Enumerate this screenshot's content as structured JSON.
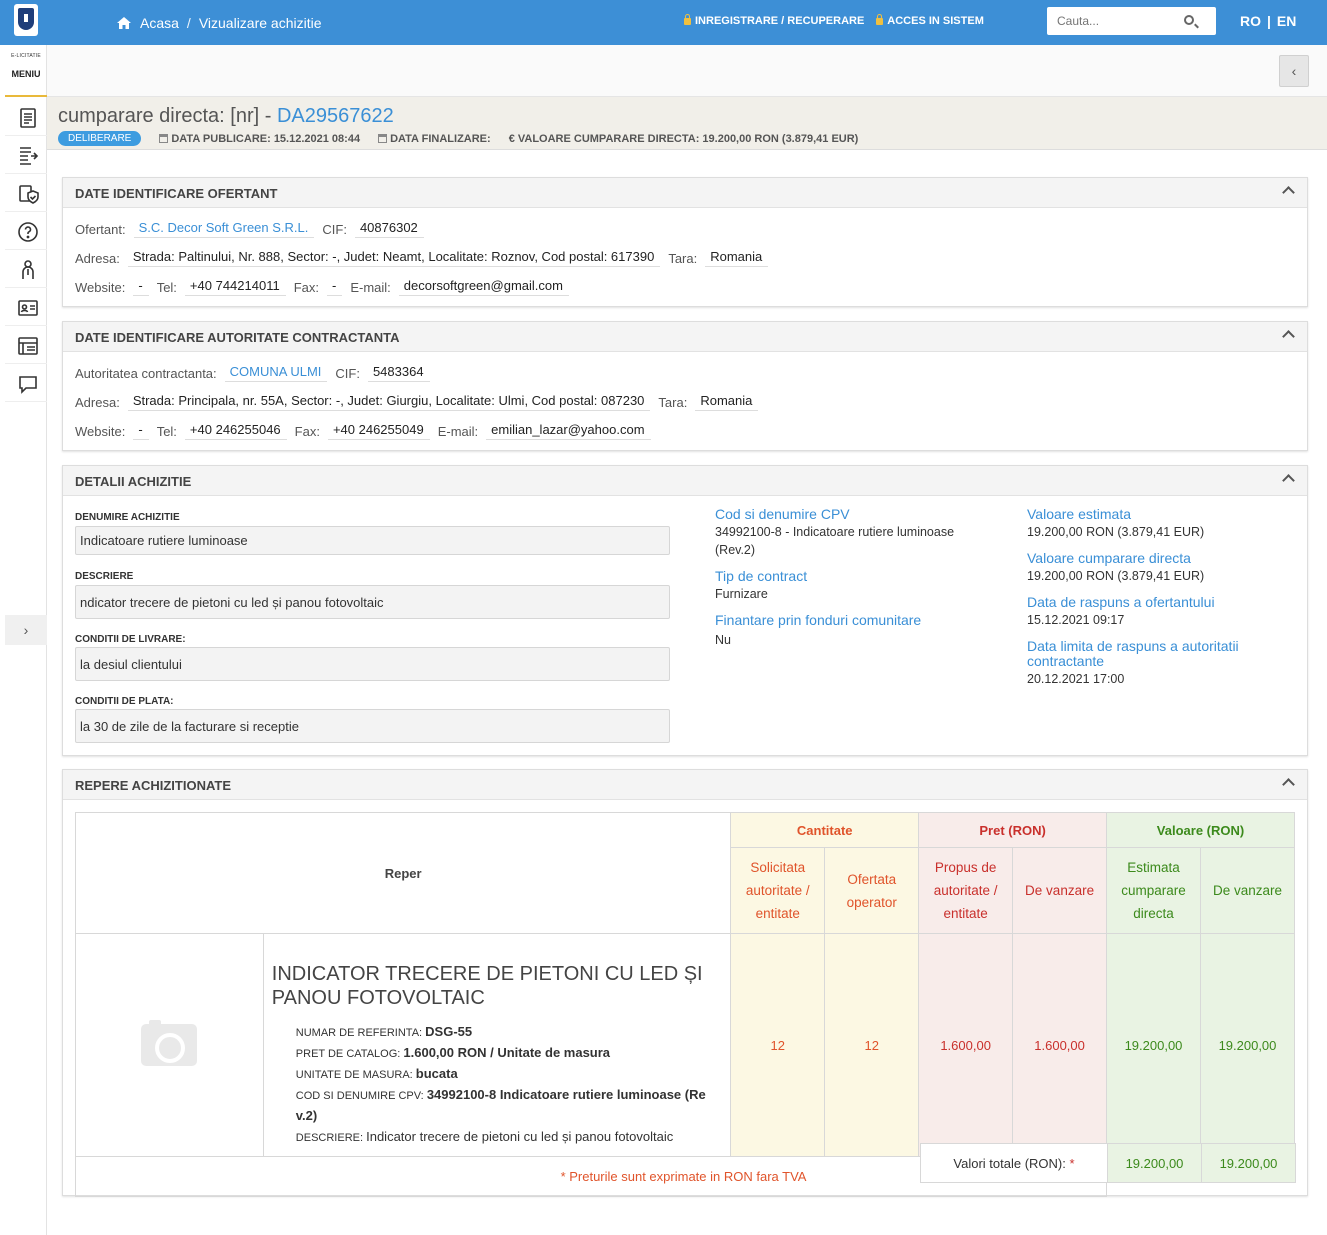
{
  "topbar": {
    "home_label": "Acasa",
    "crumb_sep": "/",
    "crumb_current": "Vizualizare achizitie",
    "register_label": "INREGISTRARE / RECUPERARE",
    "login_label": "ACCES IN SISTEM",
    "search_placeholder": "Cauta...",
    "lang_ro": "RO",
    "lang_sep": "|",
    "lang_en": "EN"
  },
  "sidebar": {
    "brand": "E-LICITATIE",
    "menu_label": "MENIU",
    "icons": [
      "document-icon",
      "export-list-icon",
      "shield-check-icon",
      "help-icon",
      "user-tie-icon",
      "id-card-icon",
      "catalog-icon",
      "chat-icon"
    ],
    "toggle": "›"
  },
  "subbar": {
    "collapse": "‹"
  },
  "header": {
    "title_prefix": "cumparare directa: [nr] - ",
    "code": "DA29567622",
    "status": "DELIBERARE",
    "pub_label": "DATA PUBLICARE: 15.12.2021 08:44",
    "fin_label": "DATA FINALIZARE:",
    "value_label": "€ VALOARE CUMPARARE DIRECTA: 19.200,00  RON (3.879,41  EUR)"
  },
  "ofertant": {
    "title": "DATE IDENTIFICARE OFERTANT",
    "lbl_ofertant": "Ofertant:",
    "name": "S.C. Decor Soft Green S.R.L.",
    "lbl_cif": "CIF:",
    "cif": "40876302",
    "lbl_adresa": "Adresa:",
    "adresa": "Strada: Paltinului, Nr. 888, Sector: -, Judet: Neamt, Localitate: Roznov, Cod postal: 617390",
    "lbl_tara": "Tara:",
    "tara": "Romania",
    "lbl_website": "Website:",
    "website": "-",
    "lbl_tel": "Tel:",
    "tel": "+40 744214011",
    "lbl_fax": "Fax:",
    "fax": "-",
    "lbl_email": "E-mail:",
    "email": "decorsoftgreen@gmail.com"
  },
  "autoritate": {
    "title": "DATE IDENTIFICARE AUTORITATE CONTRACTANTA",
    "lbl_aut": "Autoritatea contractanta:",
    "name": "COMUNA ULMI",
    "lbl_cif": "CIF:",
    "cif": "5483364",
    "lbl_adresa": "Adresa:",
    "adresa": "Strada: Principala, nr. 55A, Sector: -, Judet: Giurgiu, Localitate: Ulmi, Cod postal: 087230",
    "lbl_tara": "Tara:",
    "tara": "Romania",
    "lbl_website": "Website:",
    "website": "-",
    "lbl_tel": "Tel:",
    "tel": "+40 246255046",
    "lbl_fax": "Fax:",
    "fax": "+40 246255049",
    "lbl_email": "E-mail:",
    "email": "emilian_lazar@yahoo.com"
  },
  "detalii": {
    "title": "DETALII ACHIZITIE",
    "denumire_lbl": "DENUMIRE ACHIZITIE",
    "denumire": "Indicatoare rutiere luminoase",
    "descriere_lbl": "DESCRIERE",
    "descriere": "ndicator trecere de pietoni cu led și panou fotovoltaic",
    "livrare_lbl": "CONDITII DE LIVRARE:",
    "livrare": "la desiul clientului",
    "plata_lbl": "CONDITII DE PLATA:",
    "plata": "la 30 de zile de la facturare si receptie",
    "cpv_lbl": "Cod si denumire CPV",
    "cpv_line1": "34992100-8 - Indicatoare rutiere luminoase",
    "cpv_line2": "(Rev.2)",
    "tip_lbl": "Tip de contract",
    "tip": "Furnizare",
    "fin_lbl": "Finantare prin fonduri comunitare",
    "fin": "Nu",
    "val_est_lbl": "Valoare estimata",
    "val_est": "19.200,00  RON (3.879,41  EUR)",
    "val_cd_lbl": "Valoare cumparare directa",
    "val_cd": "19.200,00  RON (3.879,41  EUR)",
    "data_rasp_lbl": "Data de raspuns a ofertantului",
    "data_rasp": "15.12.2021 09:17",
    "data_lim_lbl1": "Data limita de raspuns a autoritatii",
    "data_lim_lbl2": "contractante",
    "data_lim": "20.12.2021 17:00"
  },
  "repere": {
    "title": "REPERE ACHIZITIONATE",
    "col_reper": "Reper",
    "grp_cant": "Cantitate",
    "grp_pret": "Pret (RON)",
    "grp_val": "Valoare (RON)",
    "sub_solicitata": [
      "Solicitata",
      "autoritate /",
      "entitate"
    ],
    "sub_ofertata": [
      "Ofertata",
      "operator"
    ],
    "sub_propus": [
      "Propus de",
      "autoritate /",
      "entitate"
    ],
    "sub_vanzare_pret": "De vanzare",
    "sub_estimata": [
      "Estimata",
      "cumparare",
      "directa"
    ],
    "sub_vanzare_val": "De vanzare",
    "item": {
      "name_line1": "INDICATOR TRECERE DE PIETONI CU LED ȘI",
      "name_line2": "PANOU FOTOVOLTAIC",
      "ref_lbl": "NUMAR DE REFERINTA:",
      "ref": "DSG-55",
      "cat_lbl": "PRET DE CATALOG:",
      "cat": "1.600,00  RON / Unitate de masura",
      "um_lbl": "UNITATE DE MASURA:",
      "um": "bucata",
      "cpv_lbl": "COD SI DENUMIRE CPV:",
      "cpv_1": "34992100-8 Indicatoare rutiere luminoase (Re",
      "cpv_2": "v.2)",
      "desc_lbl": "DESCRIERE:",
      "desc": "Indicator trecere de pietoni cu led și panou fotovoltaic",
      "cant_solicitata": "12",
      "cant_ofertata": "12",
      "pret_propus": "1.600,00",
      "pret_vanzare": "1.600,00",
      "val_estimata": "19.200,00",
      "val_vanzare": "19.200,00"
    },
    "footer_note_1": "* Preturile sunt exprimate in RON fara TVA",
    "totals_lbl": "Valori totale (RON):",
    "totals_star": "*",
    "total_estimata": "19.200,00",
    "total_vanzare": "19.200,00"
  },
  "colors": {
    "accent": "#3d8fd6",
    "cant": "#e0542b",
    "pret": "#c9302c",
    "val": "#3c8a1c"
  }
}
